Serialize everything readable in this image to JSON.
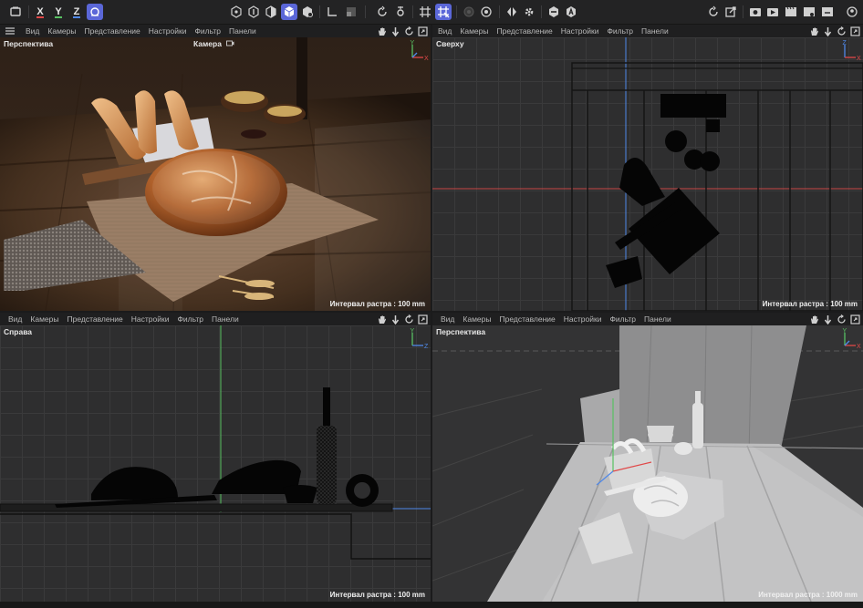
{
  "toolbar": {
    "icons": [
      "view-toggle-icon",
      "x-axis-lock",
      "y-axis-lock",
      "z-axis-lock",
      "world-coordinates-icon",
      "points-mode-icon",
      "edges-mode-icon",
      "polygons-mode-icon",
      "model-mode-icon",
      "object-mode-icon",
      "axis-mode-icon",
      "snap-mode-icon",
      "rotate-icon",
      "move-settings-icon",
      "grid-icon",
      "workplane-icon",
      "record-icon",
      "keyframe-icon",
      "symmetry-icon",
      "settings-icon",
      "hexagon-icon",
      "text-icon",
      "undo-icon",
      "export-icon",
      "render-view-icon",
      "render-icon",
      "film-icon",
      "film-settings-icon",
      "render-queue-icon",
      "user-icon"
    ],
    "axis_labels": {
      "x": "X",
      "y": "Y",
      "z": "Z"
    },
    "colors": {
      "accent": "#5b67d8",
      "x": "#e04848",
      "y": "#58c062",
      "z": "#4f88e8"
    }
  },
  "menu": [
    "Вид",
    "Камеры",
    "Представление",
    "Настройки",
    "Фильтр",
    "Панели"
  ],
  "viewports": {
    "top_left": {
      "name": "Перспектива",
      "camera": "Камера",
      "grid_note": "Интервал растра : 100 mm"
    },
    "top_right": {
      "name": "Сверху",
      "grid_note": "Интервал растра : 100 mm",
      "gizmo": {
        "a": "Z",
        "b": "X"
      }
    },
    "bottom_left": {
      "name": "Справа",
      "grid_note": "Интервал растра : 100 mm",
      "gizmo": {
        "a": "Y",
        "b": "Z"
      }
    },
    "bottom_right": {
      "name": "Перспектива",
      "grid_note": "Интервал растра : 1000 mm",
      "gizmo": {
        "a": "Y",
        "b": "X"
      }
    }
  },
  "gizmo_top_left": {
    "a": "Y",
    "b": "X"
  }
}
